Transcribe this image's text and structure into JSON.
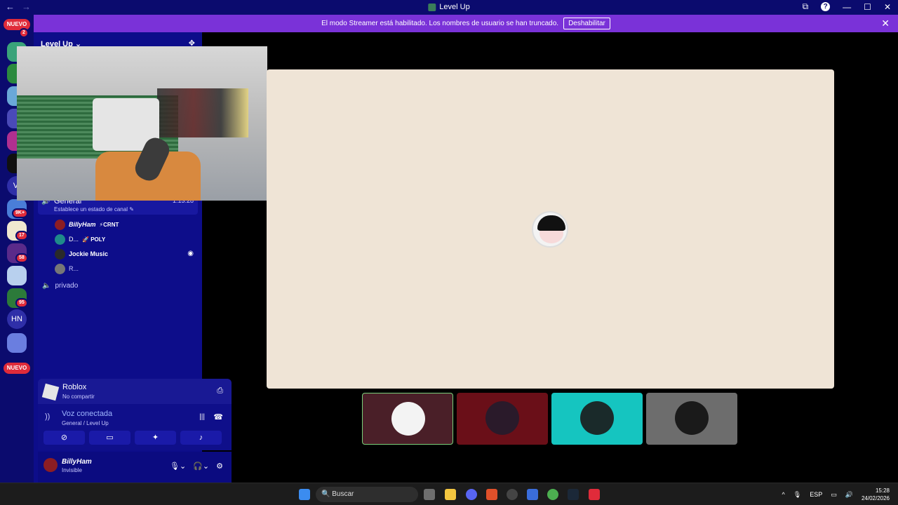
{
  "window": {
    "title": "Level Up",
    "back": "←",
    "forward": "→",
    "min": "—",
    "max": "☐",
    "close": "✕",
    "screen": "⧉",
    "help": "?"
  },
  "banner": {
    "text": "El modo Streamer está habilitado. Los nombres de usuario se han truncado.",
    "button": "Deshabilitar",
    "close": "✕"
  },
  "rail": {
    "nuevo_top": "NUEVO",
    "nuevo_bottom": "NUEVO",
    "badges": [
      "2",
      "9K+",
      "17",
      "58",
      "95"
    ],
    "text_servers": [
      "Vr",
      "HN"
    ]
  },
  "channels": {
    "server_name": "Level Up ⌄",
    "general": {
      "name": "General",
      "time": "1:13:28",
      "status": "Establece un estado de canal ✎"
    },
    "members": [
      {
        "name": "BillyHam",
        "tag": "⚡CRNT",
        "color": "#8c1d24"
      },
      {
        "name": "D...",
        "tag": "🚀 POLY",
        "color": "#1f8a8a"
      },
      {
        "name": "Jockie Music",
        "tag": "",
        "color": "#2a2a2a"
      },
      {
        "name": "R...",
        "tag": "",
        "color": "#777"
      }
    ],
    "private": "privado"
  },
  "activity": {
    "game": "Roblox",
    "game_status": "No compartir",
    "voice_title": "Voz conectada",
    "voice_sub": "General / Level Up"
  },
  "user": {
    "name": "BillyHam",
    "status": "Invisible"
  },
  "tiles": [
    {
      "name": "tile-1",
      "bg": "#4a1f28",
      "av": "#f3f3f3"
    },
    {
      "name": "tile-2",
      "bg": "#6a0f18",
      "av": "#3a1a1a"
    },
    {
      "name": "tile-3",
      "bg": "#15c5c0",
      "av": "#222"
    },
    {
      "name": "tile-4",
      "bg": "#6d6d6d",
      "av": "#1a1a1a"
    }
  ],
  "taskbar": {
    "search_placeholder": "Buscar",
    "lang": "ESP",
    "time": "15:28",
    "date": "24/02/2026",
    "chevron": "^",
    "icon_colors": [
      "#f3c640",
      "#3a7bd5",
      "#5865f2",
      "#e0502a",
      "#444",
      "#3a6ddb",
      "#4caf50",
      "#1b2838",
      "#e02b3a"
    ]
  }
}
